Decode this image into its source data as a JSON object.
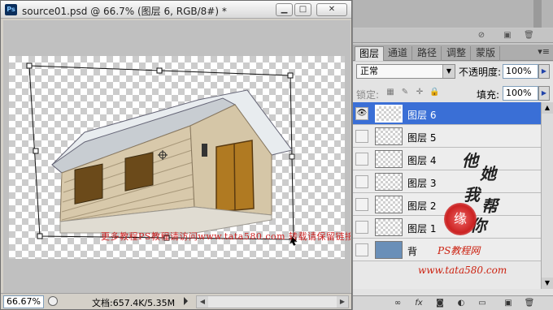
{
  "document": {
    "title": "source01.psd @ 66.7% (图层 6, RGB/8#) *",
    "app_icon": "Ps",
    "zoom": "66.67%",
    "doc_info": "文档:657.4K/5.35M",
    "watermark_text": "更多教程PS教程请访问www.tata580.com 转载请保留链接!"
  },
  "window_controls": {
    "minimize": "▁",
    "maximize": "□",
    "close": "✕"
  },
  "panel": {
    "tabs": [
      "图层",
      "通道",
      "路径",
      "调整",
      "蒙版"
    ],
    "active_tab": 0,
    "menu_icon": "▾≡",
    "blend_mode": "正常",
    "opacity_label": "不透明度:",
    "opacity_value": "100%",
    "lock_label": "锁定:",
    "fill_label": "填充:",
    "fill_value": "100%"
  },
  "layers": [
    {
      "name": "图层 6",
      "selected": true,
      "visible": true
    },
    {
      "name": "图层 5",
      "selected": false,
      "visible": false
    },
    {
      "name": "图层 4",
      "selected": false,
      "visible": false
    },
    {
      "name": "图层 3",
      "selected": false,
      "visible": false
    },
    {
      "name": "图层 2",
      "selected": false,
      "visible": false
    },
    {
      "name": "图层 1",
      "selected": false,
      "visible": false
    },
    {
      "name": "背",
      "selected": false,
      "visible": false
    }
  ],
  "signature": {
    "chars": [
      "他",
      "她",
      "我",
      "帮",
      "你"
    ],
    "seal": "缘",
    "site_label": "PS教程网",
    "site_url": "www.tata580.com"
  },
  "bottom_icons": [
    "link-icon",
    "fx-icon",
    "mask-icon",
    "adjustment-icon",
    "folder-icon",
    "new-layer-icon",
    "trash-icon"
  ]
}
